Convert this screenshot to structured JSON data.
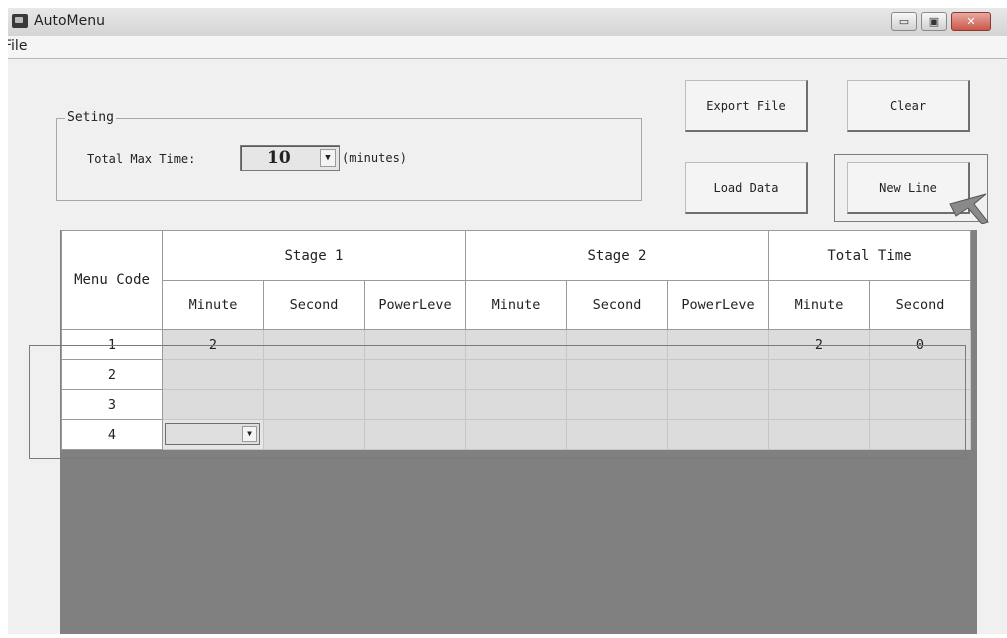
{
  "window": {
    "title": "AutoMenu"
  },
  "menubar": {
    "file": "File"
  },
  "window_buttons": {
    "minimize": "▭",
    "maximize": "▣",
    "close": "✕"
  },
  "settings": {
    "legend": "Seting",
    "total_max_time_label": "Total Max Time:",
    "total_max_time_value": "10",
    "units_label": "(minutes)"
  },
  "buttons": {
    "export_file": "Export File",
    "clear": "Clear",
    "load_data": "Load Data",
    "new_line": "New Line"
  },
  "table": {
    "menu_code_header": "Menu Code",
    "groups": [
      "Stage 1",
      "Stage 2",
      "Total Time"
    ],
    "sub_headers": [
      "Minute",
      "Second",
      "PowerLeve",
      "Minute",
      "Second",
      "PowerLeve",
      "Minute",
      "Second"
    ],
    "rows": [
      {
        "code": "1",
        "cells": [
          "2",
          "",
          "",
          "",
          "",
          "",
          "2",
          "0"
        ]
      },
      {
        "code": "2",
        "cells": [
          "",
          "",
          "",
          "",
          "",
          "",
          "",
          ""
        ]
      },
      {
        "code": "3",
        "cells": [
          "",
          "",
          "",
          "",
          "",
          "",
          "",
          ""
        ]
      },
      {
        "code": "4",
        "cells": [
          "",
          "",
          "",
          "",
          "",
          "",
          "",
          ""
        ]
      }
    ]
  },
  "colors": {
    "grid_background": "#808080",
    "cell_fill": "#dcdcdc",
    "window_bg": "#f0f0f0"
  },
  "icons": {
    "app": "app-icon",
    "dropdown": "chevron-down-icon",
    "cursor": "mouse-cursor-icon"
  }
}
